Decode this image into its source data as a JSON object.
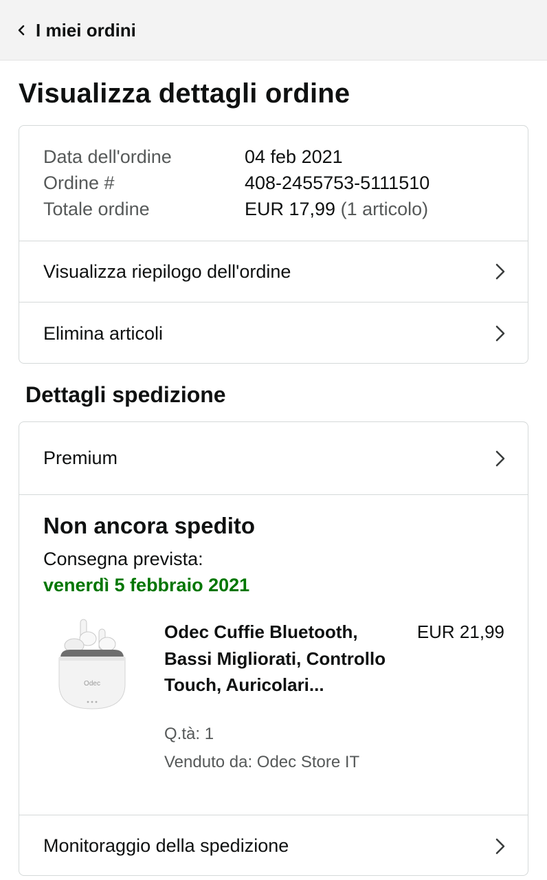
{
  "header": {
    "back_label": "I miei ordini"
  },
  "page": {
    "title": "Visualizza dettagli ordine"
  },
  "order": {
    "date_label": "Data dell'ordine",
    "date_value": "04 feb 2021",
    "number_label": "Ordine #",
    "number_value": "408-2455753-5111510",
    "total_label": "Totale ordine",
    "total_value": "EUR 17,99",
    "total_items": "(1 articolo)",
    "links": [
      {
        "label": "Visualizza riepilogo dell'ordine",
        "icon": "chevron-right-icon"
      },
      {
        "label": "Elimina articoli",
        "icon": "chevron-right-icon"
      }
    ]
  },
  "shipping": {
    "section_title": "Dettagli spedizione",
    "service": "Premium",
    "status": "Non ancora spedito",
    "delivery_label": "Consegna prevista:",
    "delivery_date": "venerdì 5 febbraio 2021",
    "tracking_label": "Monitoraggio della spedizione",
    "item": {
      "title": "Odec Cuffie Bluetooth, Bassi Migliorati, Controllo Touch, Auricolari...",
      "price": "EUR 21,99",
      "qty": "Q.tà: 1",
      "seller": "Venduto da: Odec Store IT",
      "image_brand": "Odec"
    }
  },
  "colors": {
    "delivery_green": "#007600",
    "muted_text": "#565959",
    "border": "#d5d9d9",
    "header_bg": "#f3f3f3"
  }
}
